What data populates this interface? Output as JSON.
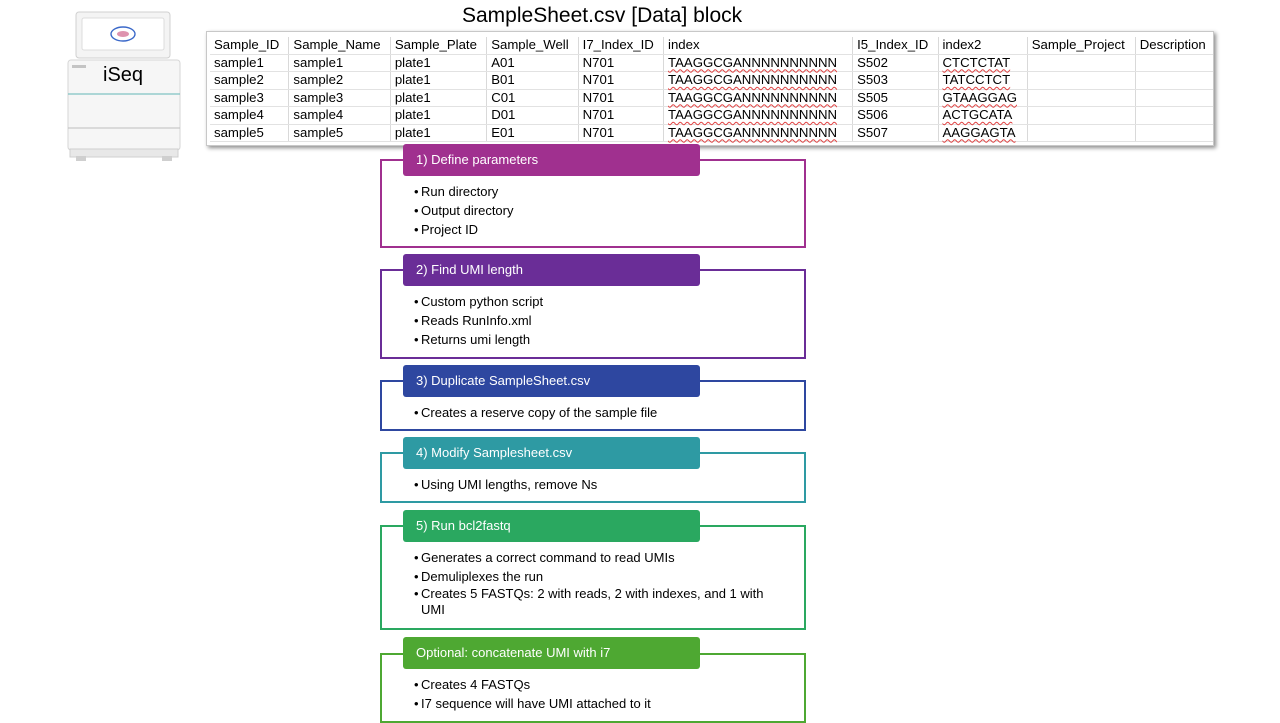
{
  "title": "SampleSheet.csv [Data] block",
  "instrument": {
    "label": "iSeq"
  },
  "table": {
    "headers": [
      "Sample_ID",
      "Sample_Name",
      "Sample_Plate",
      "Sample_Well",
      "I7_Index_ID",
      "index",
      "I5_Index_ID",
      "index2",
      "Sample_Project",
      "Description"
    ],
    "rows": [
      [
        "sample1",
        "sample1",
        "plate1",
        "A01",
        "N701",
        "TAAGGCGANNNNNNNNNN",
        "S502",
        "CTCTCTAT",
        "",
        ""
      ],
      [
        "sample2",
        "sample2",
        "plate1",
        "B01",
        "N701",
        "TAAGGCGANNNNNNNNNN",
        "S503",
        "TATCCTCT",
        "",
        ""
      ],
      [
        "sample3",
        "sample3",
        "plate1",
        "C01",
        "N701",
        "TAAGGCGANNNNNNNNNN",
        "S505",
        "GTAAGGAG",
        "",
        ""
      ],
      [
        "sample4",
        "sample4",
        "plate1",
        "D01",
        "N701",
        "TAAGGCGANNNNNNNNNN",
        "S506",
        "ACTGCATA",
        "",
        ""
      ],
      [
        "sample5",
        "sample5",
        "plate1",
        "E01",
        "N701",
        "TAAGGCGANNNNNNNNNN",
        "S507",
        "AAGGAGTA",
        "",
        ""
      ]
    ]
  },
  "steps": [
    {
      "title": "1) Define parameters",
      "color": "#a0308f",
      "items": [
        "Run directory",
        "Output directory",
        "Project ID"
      ]
    },
    {
      "title": "2) Find UMI length",
      "color": "#6a2d97",
      "items": [
        "Custom python script",
        "Reads RunInfo.xml",
        "Returns umi length"
      ]
    },
    {
      "title": "3) Duplicate SampleSheet.csv",
      "color": "#2e47a0",
      "items": [
        "Creates a reserve copy of the sample file"
      ]
    },
    {
      "title": "4) Modify Samplesheet.csv",
      "color": "#2e9aa3",
      "items": [
        "Using UMI lengths, remove Ns"
      ]
    },
    {
      "title": "5) Run bcl2fastq",
      "color": "#2aa860",
      "items": [
        "Generates a correct command to read UMIs",
        "Demuliplexes the run",
        "Creates 5 FASTQs: 2 with reads, 2 with indexes, and 1 with UMI"
      ]
    },
    {
      "title": "Optional: concatenate UMI with i7",
      "color": "#4ea832",
      "items": [
        "Creates 4 FASTQs",
        "I7 sequence will have UMI attached to it"
      ]
    }
  ]
}
